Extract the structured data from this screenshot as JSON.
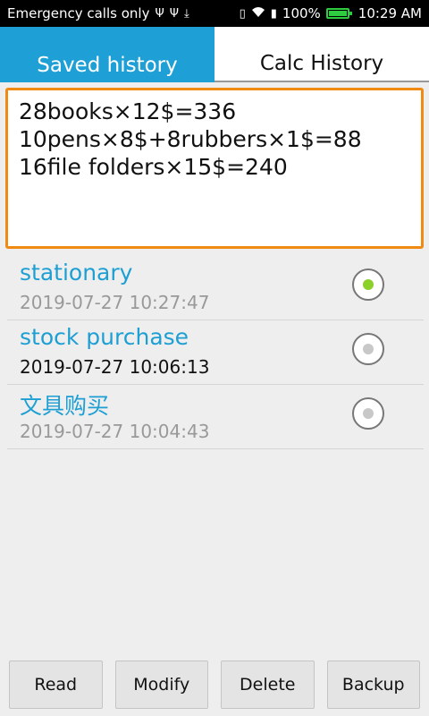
{
  "statusbar": {
    "left_text": "Emergency calls only",
    "battery_text": "100%",
    "time": "10:29 AM",
    "icons": [
      "usb-icon",
      "usb-icon",
      "download-icon",
      "vibrate-icon",
      "wifi-icon",
      "sim-icon",
      "battery-icon"
    ]
  },
  "tabs": [
    {
      "label": "Saved history",
      "active": true
    },
    {
      "label": "Calc History",
      "active": false
    }
  ],
  "history_text": "28books×12$=336\n10pens×8$+8rubbers×1$=88\n16file folders×15$=240",
  "items": [
    {
      "title": "stationary",
      "date": "2019-07-27 10:27:47",
      "checked": true
    },
    {
      "title": "stock purchase",
      "date": "2019-07-27 10:06:13",
      "checked": false
    },
    {
      "title": "文具购买",
      "date": "2019-07-27 10:04:43",
      "checked": false
    }
  ],
  "buttons": {
    "read": "Read",
    "modify": "Modify",
    "delete": "Delete",
    "backup": "Backup"
  },
  "colors": {
    "accent": "#1ea0d6",
    "border_active": "#f08a12",
    "radio_checked": "#8bd12a"
  }
}
